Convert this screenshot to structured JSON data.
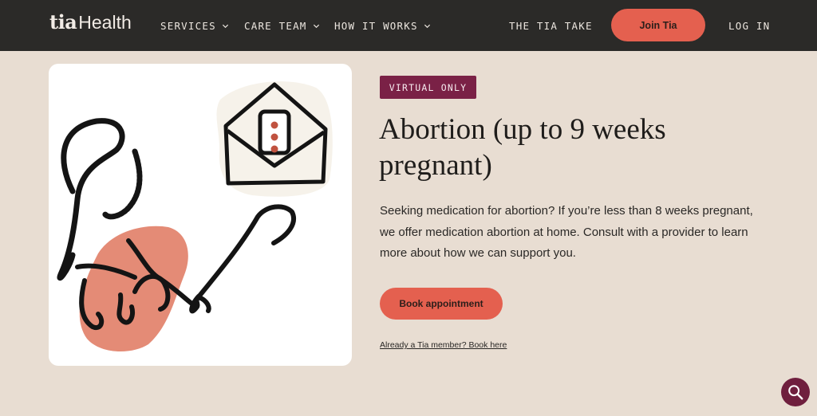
{
  "header": {
    "logo": {
      "word1": "tia",
      "word2": "Health"
    },
    "nav": [
      {
        "label": "SERVICES",
        "icon": "chevron-down-icon"
      },
      {
        "label": "CARE TEAM",
        "icon": "chevron-down-icon"
      },
      {
        "label": "HOW IT WORKS",
        "icon": "chevron-down-icon"
      }
    ],
    "tia_take": "THE TIA TAKE",
    "join_label": "Join Tia",
    "login_label": "LOG IN"
  },
  "hero": {
    "illustration": "envelope-and-stethoscope-illustration",
    "badge": "VIRTUAL ONLY",
    "title": "Abortion (up to 9 weeks pregnant)",
    "description": "Seeking medication for abortion? If you’re less than 8 weeks pregnant, we offer medication abortion at home. Consult with a provider to learn more about how we can support you.",
    "cta_label": "Book appointment",
    "member_link": "Already a Tia member? Book here"
  },
  "chat": {
    "icon": "search-icon"
  },
  "colors": {
    "header_bg": "#2b2a28",
    "page_bg": "#e8ddd2",
    "accent": "#e4604f",
    "badge_bg": "#7a2146",
    "chat_bg": "#6f1f3e"
  }
}
